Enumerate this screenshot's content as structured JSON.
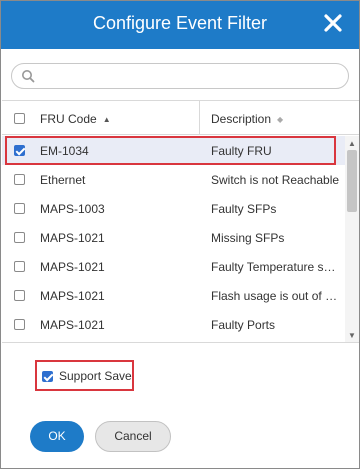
{
  "dialog": {
    "title": "Configure Event Filter",
    "close_icon": "close-icon"
  },
  "search": {
    "placeholder": "",
    "value": "",
    "icon": "search-icon"
  },
  "table": {
    "columns": [
      "FRU Code",
      "Description"
    ],
    "sort": {
      "column": "FRU Code",
      "direction": "ascending"
    },
    "header_checked": false,
    "rows": [
      {
        "fru": "EM-1034",
        "desc": "Faulty FRU",
        "checked": true
      },
      {
        "fru": "Ethernet",
        "desc": "Switch is not Reachable",
        "checked": false
      },
      {
        "fru": "MAPS-1003",
        "desc": "Faulty SFPs",
        "checked": false
      },
      {
        "fru": "MAPS-1021",
        "desc": "Missing SFPs",
        "checked": false
      },
      {
        "fru": "MAPS-1021",
        "desc": "Faulty Temperature sen...",
        "checked": false
      },
      {
        "fru": "MAPS-1021",
        "desc": "Flash usage is out of ran...",
        "checked": false
      },
      {
        "fru": "MAPS-1021",
        "desc": "Faulty Ports",
        "checked": false
      }
    ]
  },
  "options": {
    "support_save_label": "Support Save",
    "support_save_checked": true
  },
  "footer": {
    "ok_label": "OK",
    "cancel_label": "Cancel"
  },
  "colors": {
    "header_blue": "#1e7bc8",
    "checkbox_blue": "#2e6fcf",
    "highlight_red": "#d9363e",
    "selected_row": "#e9ecf6"
  }
}
